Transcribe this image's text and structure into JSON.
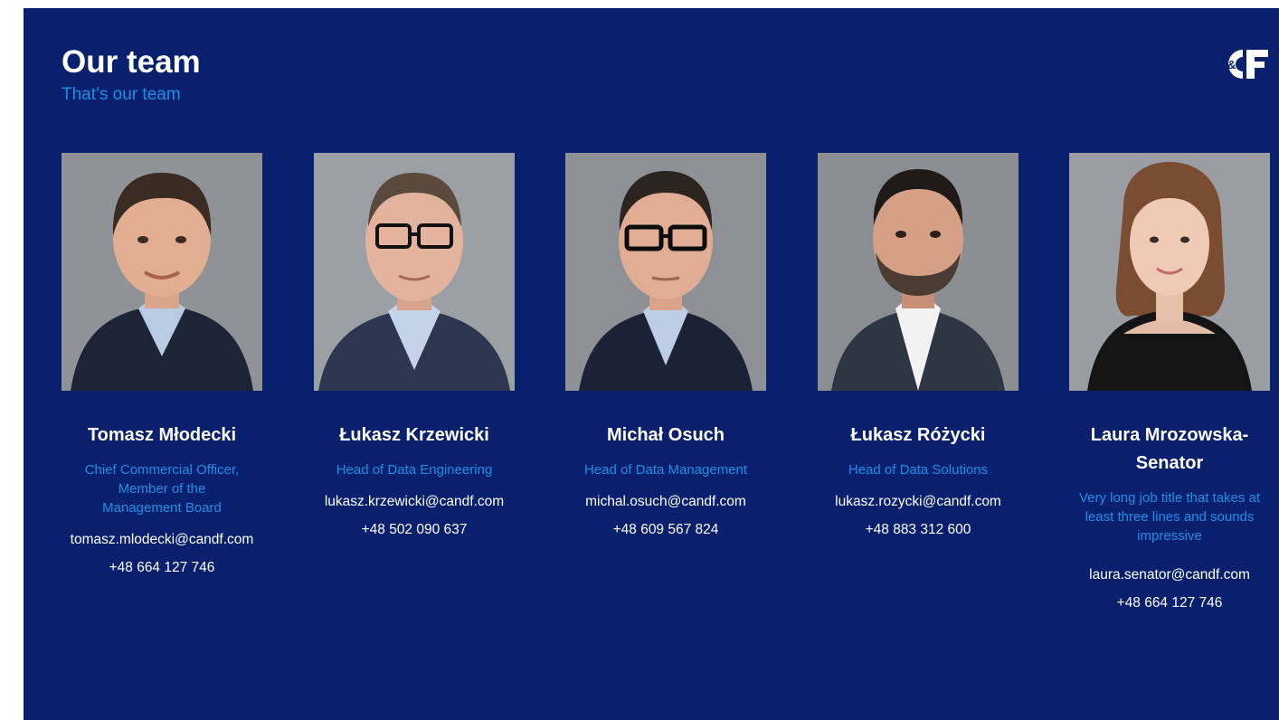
{
  "header": {
    "title": "Our team",
    "subtitle": "That’s our team"
  },
  "logo": {
    "icon": "candf-logo-icon",
    "color": "#ffffff"
  },
  "colors": {
    "background": "#08206e",
    "accent": "#1e8fe6",
    "text": "#ffffff"
  },
  "team": [
    {
      "name": "Tomasz Młodecki",
      "role_lines": [
        "Chief Commercial Officer,",
        "Member of the",
        "Management Board"
      ],
      "email": "tomasz.mlodecki@candf.com",
      "phone": "+48 664 127 746",
      "photo": "portrait-man-suit"
    },
    {
      "name": "Łukasz Krzewicki",
      "role_lines": [
        "Head of Data Engineering"
      ],
      "email": "lukasz.krzewicki@candf.com",
      "phone": "+48 502 090 637",
      "photo": "portrait-man-glasses"
    },
    {
      "name": "Michał Osuch",
      "role_lines": [
        "Head of Data Management"
      ],
      "email": "michal.osuch@candf.com",
      "phone": "+48 609 567 824",
      "photo": "portrait-man-glasses"
    },
    {
      "name": "Łukasz Różycki",
      "role_lines": [
        "Head of Data Solutions"
      ],
      "email": "lukasz.rozycki@candf.com",
      "phone": "+48 883 312 600",
      "photo": "portrait-man-beard"
    },
    {
      "name_lines": [
        "Laura Mrozowska-",
        "Senator"
      ],
      "role_lines": [
        "Very long job title that takes at",
        "least three lines and sounds",
        "impressive"
      ],
      "email": "laura.senator@candf.com",
      "phone": "+48 664 127 746",
      "photo": "portrait-woman"
    }
  ]
}
